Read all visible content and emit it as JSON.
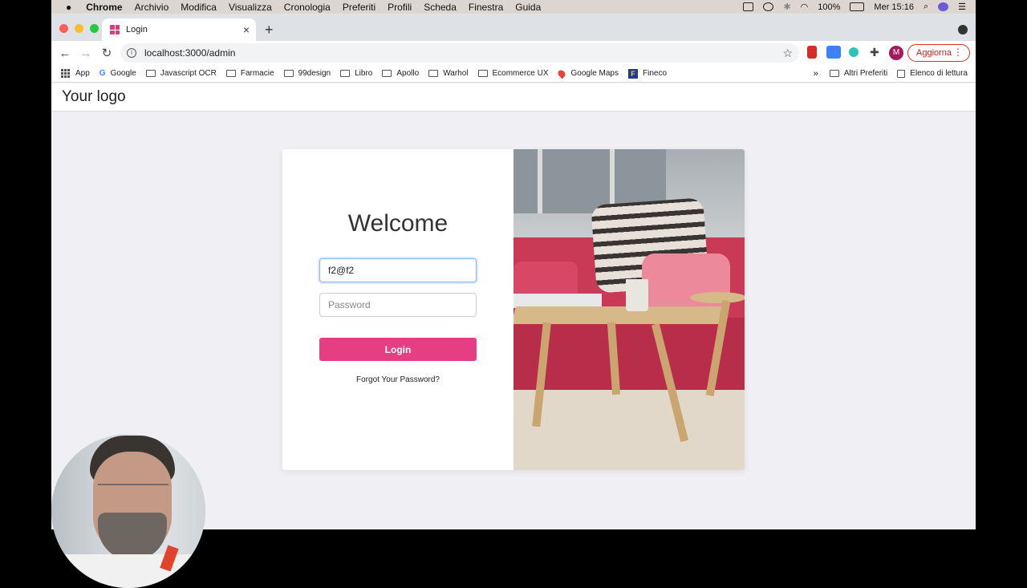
{
  "menubar": {
    "apple": "",
    "app": "Chrome",
    "items": [
      "Archivio",
      "Modifica",
      "Visualizza",
      "Cronologia",
      "Preferiti",
      "Profili",
      "Scheda",
      "Finestra",
      "Guida"
    ],
    "battery": "100%",
    "clock": "Mer 15:16"
  },
  "tab": {
    "title": "Login",
    "close": "×",
    "new": "+"
  },
  "toolbar": {
    "back": "←",
    "forward": "→",
    "reload": "↻",
    "url": "localhost:3000/admin",
    "star": "☆",
    "avatar": "M",
    "update_label": "Aggiorna",
    "update_menu": "⋮"
  },
  "bookmarks": {
    "items": [
      {
        "label": "App",
        "icon": "apps-icon"
      },
      {
        "label": "Google",
        "icon": "google-icon"
      },
      {
        "label": "Javascript OCR",
        "icon": "folder-icon"
      },
      {
        "label": "Farmacie",
        "icon": "folder-icon"
      },
      {
        "label": "99design",
        "icon": "folder-icon"
      },
      {
        "label": "Libro",
        "icon": "folder-icon"
      },
      {
        "label": "Apollo",
        "icon": "folder-icon"
      },
      {
        "label": "Warhol",
        "icon": "folder-icon"
      },
      {
        "label": "Ecommerce UX",
        "icon": "folder-icon"
      },
      {
        "label": "Google Maps",
        "icon": "maps-icon"
      },
      {
        "label": "Fineco",
        "icon": "fineco-icon"
      }
    ],
    "overflow": "»",
    "others": "Altri Preferiti",
    "reading_list": "Elenco di lettura"
  },
  "page": {
    "logo": "Your logo",
    "welcome": "Welcome",
    "email_value": "f2@f2",
    "password_placeholder": "Password",
    "login_label": "Login",
    "forgot_label": "Forgot Your Password?"
  },
  "colors": {
    "accent": "#e63e82",
    "page_bg": "#efeff4",
    "update_red": "#d93025"
  }
}
